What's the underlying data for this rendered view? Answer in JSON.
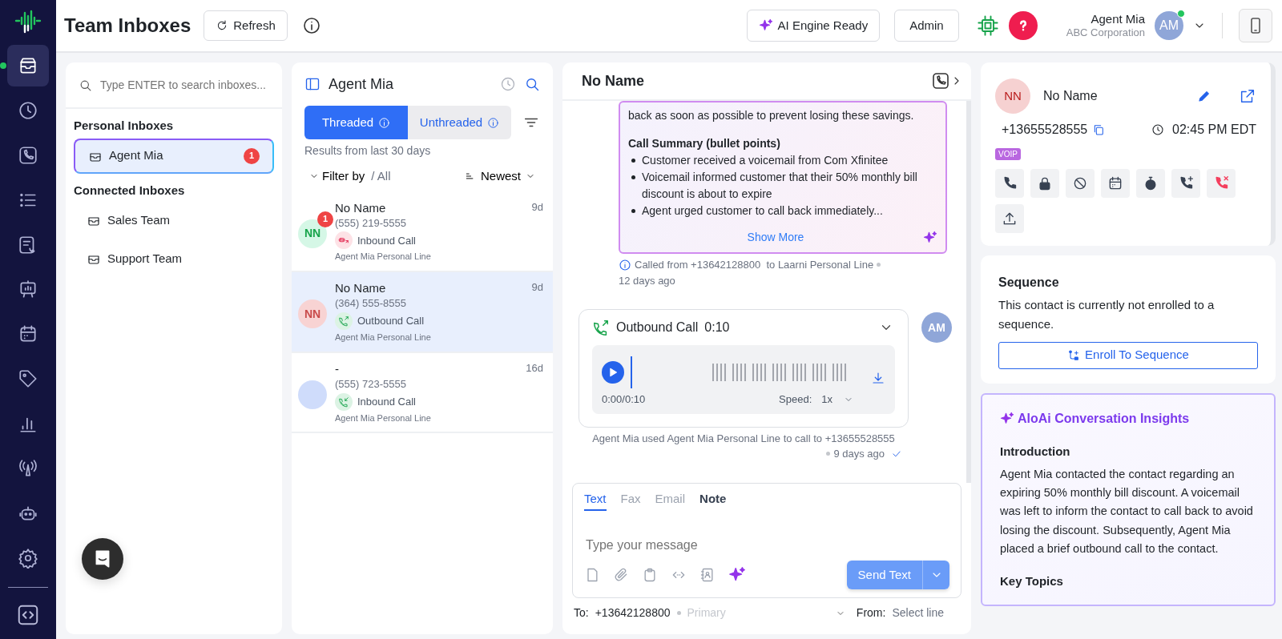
{
  "app_sidebar": {
    "nav_items": [
      {
        "selected": true
      },
      {
        "selected": false
      },
      {
        "selected": false
      },
      {
        "selected": false
      },
      {
        "selected": false
      },
      {
        "selected": false
      },
      {
        "selected": false
      },
      {
        "selected": false
      },
      {
        "selected": false
      },
      {
        "selected": false
      },
      {
        "selected": false
      },
      {
        "selected": false
      }
    ]
  },
  "header": {
    "title": "Team Inboxes",
    "refresh_button": "Refresh",
    "ai_button": "AI Engine Ready",
    "admin_button": "Admin",
    "user": {
      "name": "Agent Mia",
      "company": "ABC Corporation",
      "initials": "AM",
      "online": true
    }
  },
  "inboxes": {
    "search": {
      "placeholder": "Type ENTER to search inboxes..."
    },
    "groups": [
      {
        "title": "Personal Inboxes",
        "items": [
          {
            "label": "Agent Mia",
            "badge": "1",
            "selected": true
          }
        ]
      },
      {
        "title": "Connected Inboxes",
        "items": [
          {
            "label": "Sales Team",
            "selected": false
          },
          {
            "label": "Support Team",
            "selected": false
          }
        ]
      }
    ]
  },
  "threads": {
    "title": "Agent Mia",
    "tabs": [
      {
        "label": "Threaded",
        "selected": true
      },
      {
        "label": "Unthreaded",
        "selected": false
      }
    ],
    "results_note": "Results from last 30 days",
    "filter_label": "Filter by",
    "filter_value": "/ All",
    "sort": "Newest",
    "items": [
      {
        "name": "No Name",
        "phone": "(555) 219-5555",
        "kind": "voicemail",
        "call_label": "Inbound Call",
        "line": "Agent Mia Personal Line",
        "age": "9d",
        "initials": "NN",
        "color": "#d5f7e6",
        "unread": "1",
        "selected": false
      },
      {
        "name": "No Name",
        "phone": "(364) 555-8555",
        "kind": "outbound",
        "call_label": "Outbound Call",
        "line": "Agent Mia Personal Line",
        "age": "9d",
        "initials": "NN",
        "color": "#f8d3d3",
        "selected": true
      },
      {
        "name": "-",
        "phone": "(555) 723-5555",
        "kind": "inbound",
        "call_label": "Inbound Call",
        "line": "Agent Mia Personal Line",
        "age": "16d",
        "color": "#cfdcfb",
        "selected": false
      }
    ]
  },
  "conversation": {
    "title": "No Name",
    "summary_card": {
      "lead_text": "back as soon as possible to prevent losing these savings.",
      "heading": "Call Summary (bullet points)",
      "bullets": [
        "Customer received a voicemail from Com Xfinitee",
        "Voicemail informed customer that their 50% monthly bill discount is about to expire",
        "Agent urged customer to call back immediately..."
      ],
      "show_more": "Show More"
    },
    "summary_meta": {
      "text": "Called from +13642128800  to Laarni Personal Line",
      "time": "12 days ago"
    },
    "call": {
      "kind": "outbound",
      "title": "Outbound Call",
      "duration": "0:10",
      "level": 0,
      "time_label": "0:00/0:10",
      "speed_label": "Speed:",
      "speed": "1x",
      "avatar": "AM",
      "caption": "Agent Mia used Agent Mia Personal Line to call to +13655528555",
      "time": "9 days ago"
    },
    "composer": {
      "tabs": [
        {
          "label": "Text",
          "selected": true,
          "disabled": false
        },
        {
          "label": "Fax",
          "selected": false,
          "disabled": true
        },
        {
          "label": "Email",
          "selected": false,
          "disabled": true
        },
        {
          "label": "Note",
          "selected": false,
          "disabled": false
        }
      ],
      "placeholder": "Type your message",
      "send_button": "Send Text",
      "to_label": "To:",
      "to_number": "+13642128800",
      "to_tag": "Primary",
      "from_label": "From:",
      "from_placeholder": "Select line"
    }
  },
  "contact": {
    "initials": "NN",
    "name": "No Name",
    "phone": "+13655528555",
    "local_time": "02:45 PM EDT",
    "tag": "VOIP"
  },
  "sequence": {
    "title": "Sequence",
    "text": "This contact is currently not enrolled to a sequence.",
    "button": "Enroll To Sequence"
  },
  "insights": {
    "title": "AloAi Conversation Insights",
    "sections": [
      {
        "heading": "Introduction",
        "text": "Agent Mia contacted the contact regarding an expiring 50% monthly bill discount. A voicemail was left to inform the contact to call back to avoid losing the discount. Subsequently, Agent Mia placed a brief outbound call to the contact."
      },
      {
        "heading": "Key Topics"
      }
    ]
  }
}
